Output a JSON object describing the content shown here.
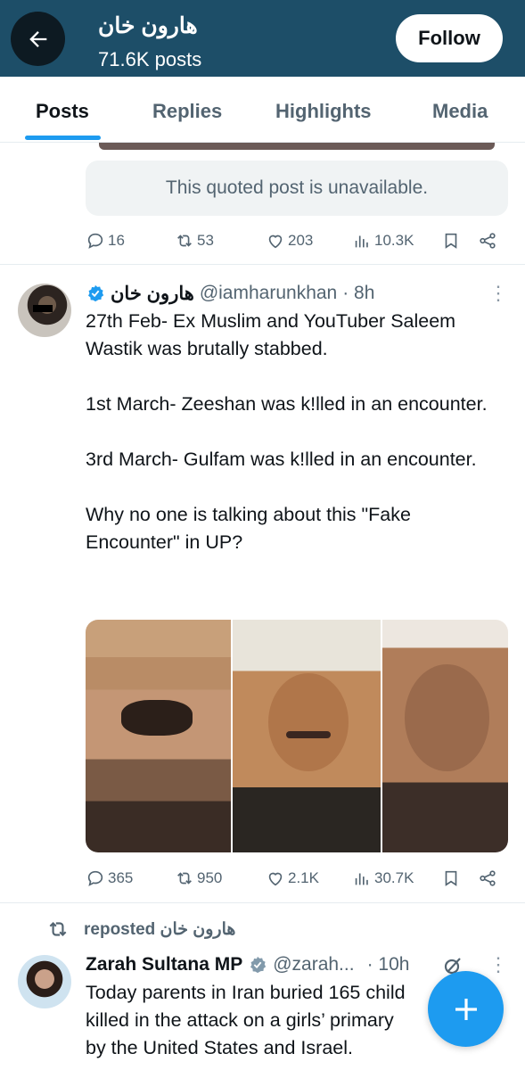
{
  "header": {
    "name": "هارون خان",
    "post_count": "71.6K posts",
    "follow_label": "Follow"
  },
  "tabs": [
    {
      "label": "Posts",
      "active": true
    },
    {
      "label": "Replies",
      "active": false
    },
    {
      "label": "Highlights",
      "active": false
    },
    {
      "label": "Media",
      "active": false
    }
  ],
  "prev_post": {
    "quoted_text": "This quoted post is unavailable.",
    "replies": "16",
    "reposts": "53",
    "likes": "203",
    "views": "10.3K"
  },
  "post": {
    "author_name": "هارون خان",
    "handle": "@iamharunkhan",
    "time": "· 8h",
    "paragraphs": [
      "27th Feb- Ex Muslim and YouTuber Saleem Wastik was brutally stabbed.",
      "1st March- Zeeshan was k!lled in an encounter.",
      "3rd March- Gulfam was k!lled in an encounter.",
      "Why no one is talking about this \"Fake Encounter\" in UP?"
    ],
    "replies": "365",
    "reposts": "950",
    "likes": "2.1K",
    "views": "30.7K"
  },
  "repost": {
    "label": "reposted هارون خان",
    "author_name": "Zarah Sultana MP",
    "handle": "@zarah...",
    "time": "· 10h",
    "lines": [
      "Today parents in Iran buried 165 child",
      "killed in the attack on a girls’ primary",
      "by the United States and Israel."
    ]
  },
  "icons": [
    "back-arrow-icon",
    "reply-icon",
    "repost-icon",
    "like-icon",
    "views-icon",
    "bookmark-icon",
    "share-icon",
    "verified-icon",
    "more-icon",
    "grok-icon",
    "plus-icon"
  ],
  "colors": {
    "header_bg": "#1d4e68",
    "accent": "#1d9bf0",
    "muted": "#536471"
  }
}
